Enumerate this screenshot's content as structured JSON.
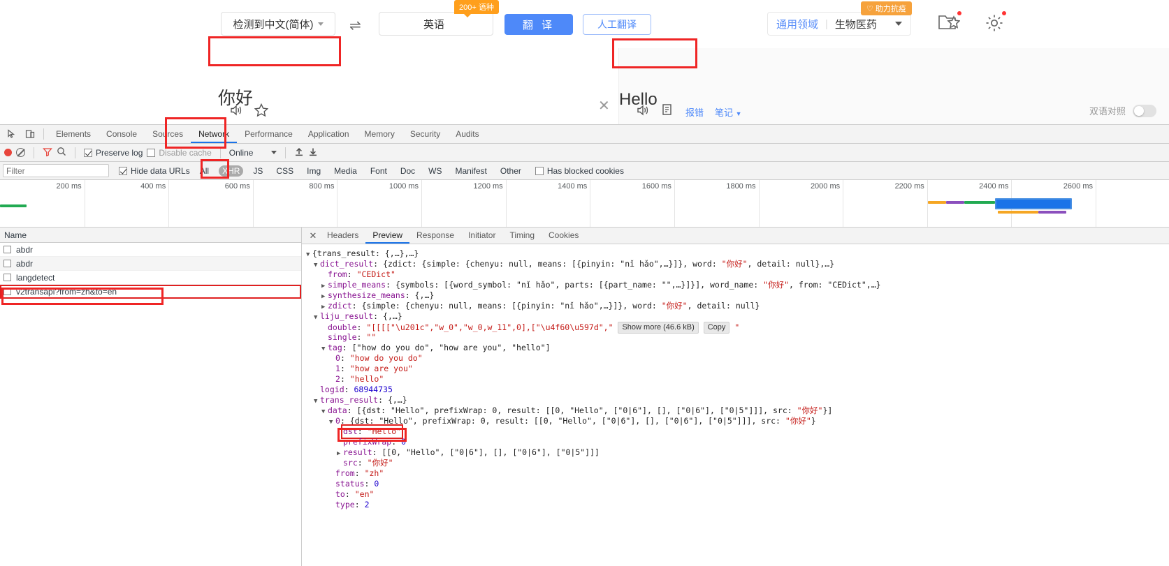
{
  "translate_app": {
    "source_lang": "检测到中文(简体)",
    "target_lang": "英语",
    "langs_badge": "200+ 语种",
    "translate_button": "翻 译",
    "manual_translate_button": "人工翻译",
    "domain_general": "通用领域",
    "domain_current": "生物医药",
    "fight_badge": "助力抗疫",
    "source_text": "你好",
    "target_text": "Hello",
    "clear_icon": "close-icon",
    "left_tools": {
      "speaker": "speaker-icon",
      "favorite": "star-icon"
    },
    "right_tools": {
      "speaker": "speaker-icon",
      "copy": "copy-icon",
      "report_error": "报错",
      "notes": "笔记"
    },
    "bilingual_label": "双语对照"
  },
  "devtools": {
    "tabs": [
      {
        "label": "Elements",
        "active": false
      },
      {
        "label": "Console",
        "active": false
      },
      {
        "label": "Sources",
        "active": false
      },
      {
        "label": "Network",
        "active": true
      },
      {
        "label": "Performance",
        "active": false
      },
      {
        "label": "Application",
        "active": false
      },
      {
        "label": "Memory",
        "active": false
      },
      {
        "label": "Security",
        "active": false
      },
      {
        "label": "Audits",
        "active": false
      }
    ],
    "toolbar": {
      "record_icon": "record-icon",
      "clear_icon": "clear-icon",
      "filter_icon": "filter-icon",
      "search_icon": "search-icon",
      "preserve_log": "Preserve log",
      "preserve_log_checked": true,
      "disable_cache": "Disable cache",
      "disable_cache_checked": false,
      "throttling": "Online",
      "import_icon": "import-har-icon",
      "export_icon": "export-har-icon"
    },
    "filterbar": {
      "filter_placeholder": "Filter",
      "filter_value": "",
      "hide_data_urls": "Hide data URLs",
      "hide_data_urls_checked": true,
      "chips": [
        {
          "label": "All",
          "active": false
        },
        {
          "label": "XHR",
          "active": true
        },
        {
          "label": "JS",
          "active": false
        },
        {
          "label": "CSS",
          "active": false
        },
        {
          "label": "Img",
          "active": false
        },
        {
          "label": "Media",
          "active": false
        },
        {
          "label": "Font",
          "active": false
        },
        {
          "label": "Doc",
          "active": false
        },
        {
          "label": "WS",
          "active": false
        },
        {
          "label": "Manifest",
          "active": false
        },
        {
          "label": "Other",
          "active": false
        }
      ],
      "has_blocked_cookies": "Has blocked cookies",
      "has_blocked_cookies_checked": false
    },
    "overview": {
      "ticks": [
        "200 ms",
        "400 ms",
        "600 ms",
        "800 ms",
        "1000 ms",
        "1200 ms",
        "1400 ms",
        "1600 ms",
        "1800 ms",
        "2000 ms",
        "2200 ms",
        "2400 ms",
        "2600 ms"
      ],
      "colors": {
        "stalled": "#f5a623",
        "dns": "#8b4fbd",
        "request": "#22aa52",
        "download": "#1a73e8"
      }
    },
    "requests": {
      "column_name": "Name",
      "rows": [
        {
          "name": "abdr",
          "selected": false
        },
        {
          "name": "abdr",
          "selected": false
        },
        {
          "name": "langdetect",
          "selected": false
        },
        {
          "name": "v2transapi?from=zh&to=en",
          "selected": true
        }
      ]
    },
    "detail": {
      "close_icon": "close-icon",
      "tabs": [
        {
          "label": "Headers",
          "active": false
        },
        {
          "label": "Preview",
          "active": true
        },
        {
          "label": "Response",
          "active": false
        },
        {
          "label": "Initiator",
          "active": false
        },
        {
          "label": "Timing",
          "active": false
        },
        {
          "label": "Cookies",
          "active": false
        }
      ],
      "show_more_label": "Show more (46.6 kB)",
      "copy_label": "Copy",
      "json_lines": [
        {
          "indent": 0,
          "arrow": "▼",
          "parts": [
            {
              "t": "{trans_result: {,…},…}",
              "c": "p"
            }
          ]
        },
        {
          "indent": 1,
          "arrow": "▼",
          "parts": [
            {
              "t": "dict_result",
              "c": "k"
            },
            {
              "t": ": {zdict: {simple: {chenyu: null, means: [{pinyin: \"nǐ hǎo\",…}]}, word: ",
              "c": "p"
            },
            {
              "t": "\"你好\"",
              "c": "ks"
            },
            {
              "t": ", detail: null},…}",
              "c": "p"
            }
          ]
        },
        {
          "indent": 2,
          "arrow": "",
          "parts": [
            {
              "t": "from",
              "c": "k"
            },
            {
              "t": ": ",
              "c": "p"
            },
            {
              "t": "\"CEDict\"",
              "c": "ks"
            }
          ]
        },
        {
          "indent": 2,
          "arrow": "▶",
          "parts": [
            {
              "t": "simple_means",
              "c": "k"
            },
            {
              "t": ": {symbols: [{word_symbol: \"nǐ hǎo\", parts: [{part_name: \"\",…}]}], word_name: ",
              "c": "p"
            },
            {
              "t": "\"你好\"",
              "c": "ks"
            },
            {
              "t": ", from: \"CEDict\",…}",
              "c": "p"
            }
          ]
        },
        {
          "indent": 2,
          "arrow": "▶",
          "parts": [
            {
              "t": "synthesize_means",
              "c": "k"
            },
            {
              "t": ": {,…}",
              "c": "p"
            }
          ]
        },
        {
          "indent": 2,
          "arrow": "▶",
          "parts": [
            {
              "t": "zdict",
              "c": "k"
            },
            {
              "t": ": {simple: {chenyu: null, means: [{pinyin: \"nǐ hǎo\",…}]}, word: ",
              "c": "p"
            },
            {
              "t": "\"你好\"",
              "c": "ks"
            },
            {
              "t": ", detail: null}",
              "c": "p"
            }
          ]
        },
        {
          "indent": 1,
          "arrow": "▼",
          "parts": [
            {
              "t": "liju_result",
              "c": "k"
            },
            {
              "t": ": {,…}",
              "c": "p"
            }
          ]
        },
        {
          "indent": 2,
          "arrow": "",
          "parts": [
            {
              "t": "double",
              "c": "k"
            },
            {
              "t": ": ",
              "c": "p"
            },
            {
              "t": "\"[[[[\"\\u201c\",\"w_0\",\"w_0,w_11\",0],[\"\\u4f60\\u597d\",\"",
              "c": "ks"
            }
          ],
          "buttons": [
            "show_more",
            "copy"
          ],
          "tail": "\""
        },
        {
          "indent": 2,
          "arrow": "",
          "parts": [
            {
              "t": "single",
              "c": "k"
            },
            {
              "t": ": ",
              "c": "p"
            },
            {
              "t": "\"\"",
              "c": "ks"
            }
          ]
        },
        {
          "indent": 2,
          "arrow": "▼",
          "parts": [
            {
              "t": "tag",
              "c": "k"
            },
            {
              "t": ": [\"how do you do\", \"how are you\", \"hello\"]",
              "c": "p"
            }
          ]
        },
        {
          "indent": 3,
          "arrow": "",
          "parts": [
            {
              "t": "0",
              "c": "k"
            },
            {
              "t": ": ",
              "c": "p"
            },
            {
              "t": "\"how do you do\"",
              "c": "ks"
            }
          ]
        },
        {
          "indent": 3,
          "arrow": "",
          "parts": [
            {
              "t": "1",
              "c": "k"
            },
            {
              "t": ": ",
              "c": "p"
            },
            {
              "t": "\"how are you\"",
              "c": "ks"
            }
          ]
        },
        {
          "indent": 3,
          "arrow": "",
          "parts": [
            {
              "t": "2",
              "c": "k"
            },
            {
              "t": ": ",
              "c": "p"
            },
            {
              "t": "\"hello\"",
              "c": "ks"
            }
          ]
        },
        {
          "indent": 1,
          "arrow": "",
          "parts": [
            {
              "t": "logid",
              "c": "k"
            },
            {
              "t": ": ",
              "c": "p"
            },
            {
              "t": "68944735",
              "c": "n"
            }
          ]
        },
        {
          "indent": 1,
          "arrow": "▼",
          "parts": [
            {
              "t": "trans_result",
              "c": "k"
            },
            {
              "t": ": {,…}",
              "c": "p"
            }
          ]
        },
        {
          "indent": 2,
          "arrow": "▼",
          "parts": [
            {
              "t": "data",
              "c": "k"
            },
            {
              "t": ": [{dst: \"Hello\", prefixWrap: 0, result: [[0, \"Hello\", [\"0|6\"], [], [\"0|6\"], [\"0|5\"]]], src: ",
              "c": "p"
            },
            {
              "t": "\"你好\"",
              "c": "ks"
            },
            {
              "t": "}]",
              "c": "p"
            }
          ]
        },
        {
          "indent": 3,
          "arrow": "▼",
          "parts": [
            {
              "t": "0",
              "c": "k"
            },
            {
              "t": ": {dst: \"Hello\", prefixWrap: 0, result: [[0, \"Hello\", [\"0|6\"], [], [\"0|6\"], [\"0|5\"]]], src: ",
              "c": "p"
            },
            {
              "t": "\"你好\"",
              "c": "ks"
            },
            {
              "t": "}",
              "c": "p"
            }
          ]
        },
        {
          "indent": 4,
          "arrow": "",
          "highlight": true,
          "parts": [
            {
              "t": "dst",
              "c": "k"
            },
            {
              "t": ": ",
              "c": "p"
            },
            {
              "t": "\"Hello\"",
              "c": "ks"
            }
          ]
        },
        {
          "indent": 4,
          "arrow": "",
          "parts": [
            {
              "t": "prefixWrap",
              "c": "k"
            },
            {
              "t": ": ",
              "c": "p"
            },
            {
              "t": "0",
              "c": "n"
            }
          ]
        },
        {
          "indent": 4,
          "arrow": "▶",
          "parts": [
            {
              "t": "result",
              "c": "k"
            },
            {
              "t": ": [[0, \"Hello\", [\"0|6\"], [], [\"0|6\"], [\"0|5\"]]]",
              "c": "p"
            }
          ]
        },
        {
          "indent": 4,
          "arrow": "",
          "parts": [
            {
              "t": "src",
              "c": "k"
            },
            {
              "t": ": ",
              "c": "p"
            },
            {
              "t": "\"你好\"",
              "c": "ks"
            }
          ]
        },
        {
          "indent": 3,
          "arrow": "",
          "parts": [
            {
              "t": "from",
              "c": "k"
            },
            {
              "t": ": ",
              "c": "p"
            },
            {
              "t": "\"zh\"",
              "c": "ks"
            }
          ]
        },
        {
          "indent": 3,
          "arrow": "",
          "parts": [
            {
              "t": "status",
              "c": "k"
            },
            {
              "t": ": ",
              "c": "p"
            },
            {
              "t": "0",
              "c": "n"
            }
          ]
        },
        {
          "indent": 3,
          "arrow": "",
          "parts": [
            {
              "t": "to",
              "c": "k"
            },
            {
              "t": ": ",
              "c": "p"
            },
            {
              "t": "\"en\"",
              "c": "ks"
            }
          ]
        },
        {
          "indent": 3,
          "arrow": "",
          "parts": [
            {
              "t": "type",
              "c": "k"
            },
            {
              "t": ": ",
              "c": "p"
            },
            {
              "t": "2",
              "c": "n"
            }
          ]
        }
      ]
    }
  }
}
